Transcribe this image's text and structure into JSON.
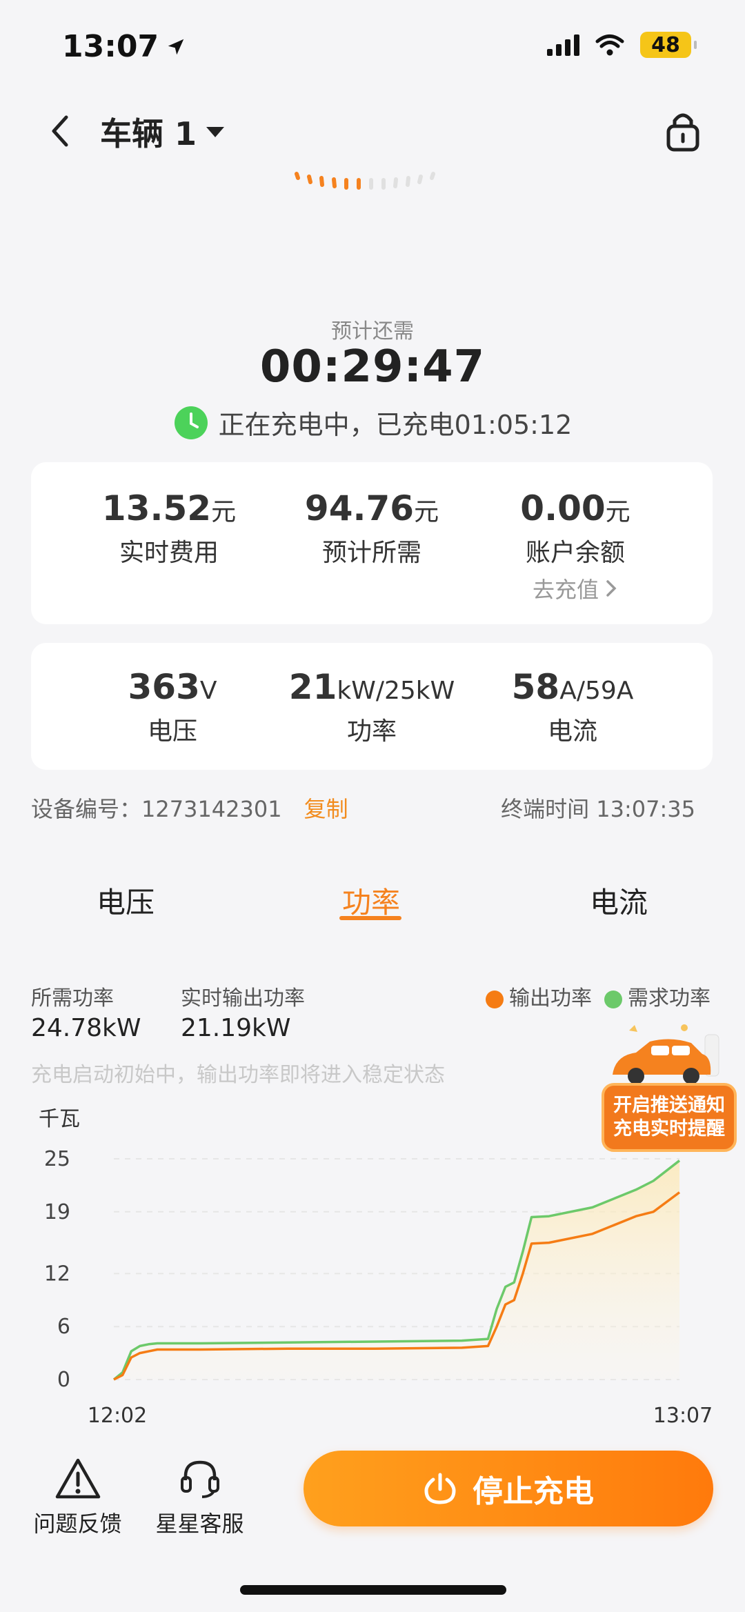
{
  "status_bar": {
    "time": "13:07",
    "battery": "48"
  },
  "header": {
    "vehicle": "车辆 1"
  },
  "remaining": {
    "label": "预计还需",
    "time": "00:29:47",
    "status_text": "正在充电中，已充电01:05:12"
  },
  "cost_card": {
    "realtime": {
      "value": "13.52",
      "unit": "元",
      "label": "实时费用"
    },
    "estimate": {
      "value": "94.76",
      "unit": "元",
      "label": "预计所需"
    },
    "balance": {
      "value": "0.00",
      "unit": "元",
      "label": "账户余额",
      "action": "去充值"
    }
  },
  "power_card": {
    "voltage": {
      "value": "363",
      "unit": "V",
      "label": "电压"
    },
    "power": {
      "value": "21",
      "unit": "kW/25kW",
      "label": "功率"
    },
    "current": {
      "value": "58",
      "unit": "A/59A",
      "label": "电流"
    }
  },
  "device": {
    "label": "设备编号：1273142301",
    "copy": "复制",
    "terminal_time": "终端时间 13:07:35"
  },
  "tabs": [
    {
      "label": "电压"
    },
    {
      "label": "功率"
    },
    {
      "label": "电流"
    }
  ],
  "metrics": {
    "required_label": "所需功率",
    "required_value": "24.78kW",
    "output_label": "实时输出功率",
    "output_value": "21.19kW"
  },
  "legend": {
    "output": "输出功率",
    "demand": "需求功率"
  },
  "hint": "充电启动初始中，输出功率即将进入稳定状态",
  "promo": {
    "line1": "开启推送通知",
    "line2": "充电实时提醒"
  },
  "bottom": {
    "feedback": "问题反馈",
    "service": "星星客服",
    "stop": "停止充电"
  },
  "colors": {
    "accent": "#f5821f",
    "output_line": "#f57c14",
    "demand_line": "#6cc96a"
  },
  "chart_data": {
    "type": "line",
    "ylabel": "千瓦",
    "ylim": [
      0,
      25
    ],
    "yticks": [
      0,
      6,
      12,
      19,
      25
    ],
    "xticks": [
      "12:02",
      "13:07"
    ],
    "x": [
      0,
      1,
      2,
      3,
      4,
      5,
      10,
      20,
      30,
      40,
      43,
      44,
      45,
      46,
      47,
      48,
      50,
      55,
      60,
      62,
      65
    ],
    "series": [
      {
        "name": "输出功率",
        "values": [
          0,
          0.5,
          2.5,
          3,
          3.2,
          3.4,
          3.4,
          3.5,
          3.5,
          3.6,
          3.8,
          6,
          8.5,
          9,
          12,
          15.4,
          15.5,
          16.5,
          18.5,
          19,
          21.2
        ]
      },
      {
        "name": "需求功率",
        "values": [
          0,
          0.8,
          3.2,
          3.8,
          4,
          4.1,
          4.1,
          4.2,
          4.3,
          4.4,
          4.6,
          8,
          10.5,
          11,
          14.5,
          18.4,
          18.5,
          19.5,
          21.5,
          22.5,
          24.8
        ]
      }
    ]
  }
}
